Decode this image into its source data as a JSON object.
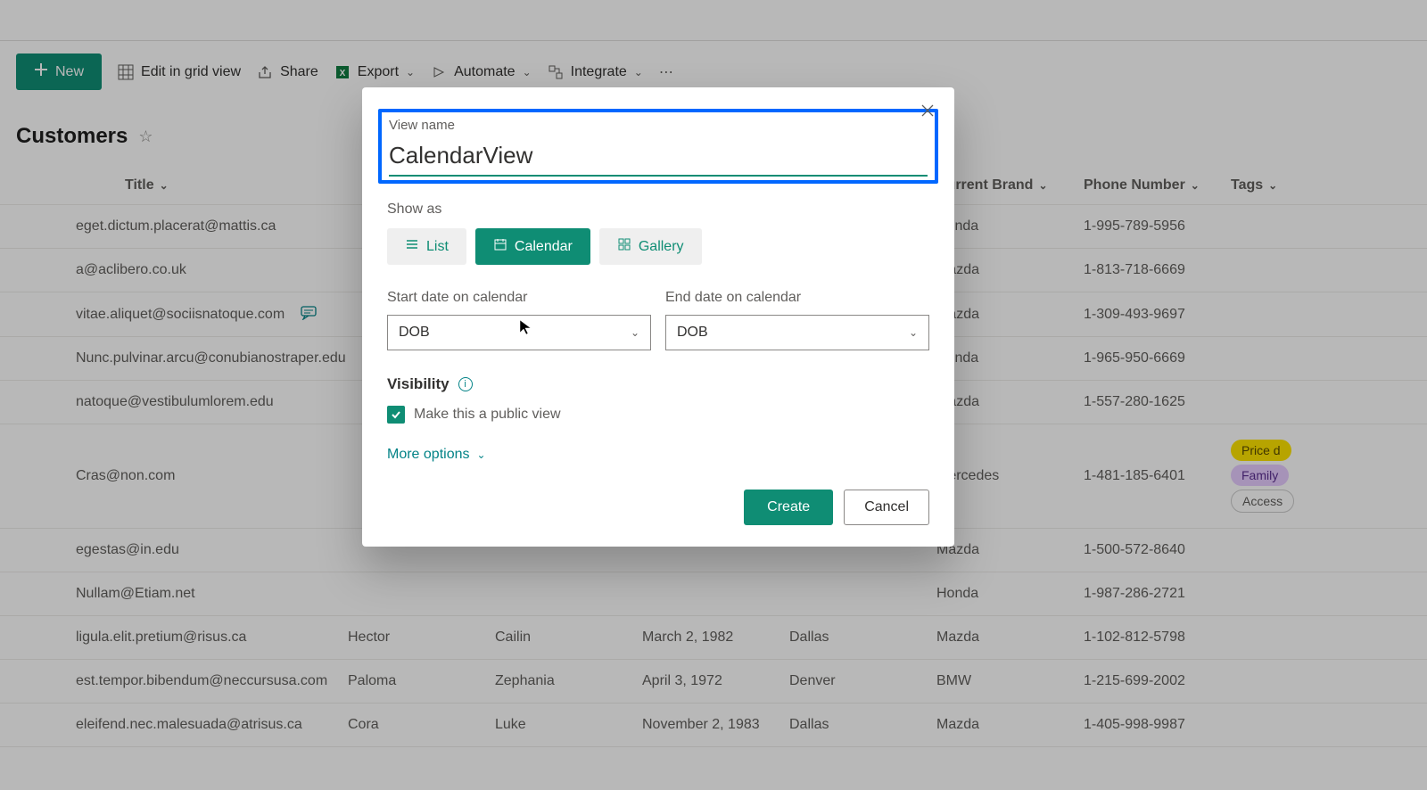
{
  "toolbar": {
    "new_label": "New",
    "edit_grid_label": "Edit in grid view",
    "share_label": "Share",
    "export_label": "Export",
    "automate_label": "Automate",
    "integrate_label": "Integrate"
  },
  "page": {
    "title": "Customers"
  },
  "table": {
    "columns": {
      "title": "Title",
      "current_brand": "Current Brand",
      "phone_number": "Phone Number",
      "tags": "Tags"
    },
    "rows": [
      {
        "title": "eget.dictum.placerat@mattis.ca",
        "fn": "",
        "ln": "",
        "dob": "",
        "city": "",
        "brand": "Honda",
        "phone": "1-995-789-5956",
        "comment": false
      },
      {
        "title": "a@aclibero.co.uk",
        "fn": "",
        "ln": "",
        "dob": "",
        "city": "",
        "brand": "Mazda",
        "phone": "1-813-718-6669",
        "comment": false
      },
      {
        "title": "vitae.aliquet@sociisnatoque.com",
        "fn": "",
        "ln": "",
        "dob": "",
        "city": "",
        "brand": "Mazda",
        "phone": "1-309-493-9697",
        "comment": true
      },
      {
        "title": "Nunc.pulvinar.arcu@conubianostraper.edu",
        "fn": "",
        "ln": "",
        "dob": "",
        "city": "",
        "brand": "Honda",
        "phone": "1-965-950-6669",
        "comment": false
      },
      {
        "title": "natoque@vestibulumlorem.edu",
        "fn": "",
        "ln": "",
        "dob": "",
        "city": "",
        "brand": "Mazda",
        "phone": "1-557-280-1625",
        "comment": false
      },
      {
        "title": "Cras@non.com",
        "fn": "",
        "ln": "",
        "dob": "",
        "city": "",
        "brand": "Mercedes",
        "phone": "1-481-185-6401",
        "comment": false,
        "tags": [
          "Price d",
          "Family",
          "Access"
        ]
      },
      {
        "title": "egestas@in.edu",
        "fn": "",
        "ln": "",
        "dob": "",
        "city": "",
        "brand": "Mazda",
        "phone": "1-500-572-8640",
        "comment": false
      },
      {
        "title": "Nullam@Etiam.net",
        "fn": "",
        "ln": "",
        "dob": "",
        "city": "",
        "brand": "Honda",
        "phone": "1-987-286-2721",
        "comment": false
      },
      {
        "title": "ligula.elit.pretium@risus.ca",
        "fn": "Hector",
        "ln": "Cailin",
        "dob": "March 2, 1982",
        "city": "Dallas",
        "brand": "Mazda",
        "phone": "1-102-812-5798",
        "comment": false
      },
      {
        "title": "est.tempor.bibendum@neccursusa.com",
        "fn": "Paloma",
        "ln": "Zephania",
        "dob": "April 3, 1972",
        "city": "Denver",
        "brand": "BMW",
        "phone": "1-215-699-2002",
        "comment": false
      },
      {
        "title": "eleifend.nec.malesuada@atrisus.ca",
        "fn": "Cora",
        "ln": "Luke",
        "dob": "November 2, 1983",
        "city": "Dallas",
        "brand": "Mazda",
        "phone": "1-405-998-9987",
        "comment": false
      }
    ]
  },
  "modal": {
    "view_name_label": "View name",
    "view_name_value": "CalendarView",
    "show_as_label": "Show as",
    "options": {
      "list": "List",
      "calendar": "Calendar",
      "gallery": "Gallery"
    },
    "start_date_label": "Start date on calendar",
    "start_date_value": "DOB",
    "end_date_label": "End date on calendar",
    "end_date_value": "DOB",
    "visibility_label": "Visibility",
    "public_view_label": "Make this a public view",
    "public_view_checked": true,
    "more_options_label": "More options",
    "create_label": "Create",
    "cancel_label": "Cancel"
  },
  "tag_colors": {
    "Price d": "tag-gold",
    "Family": "tag-purple",
    "Access": ""
  }
}
